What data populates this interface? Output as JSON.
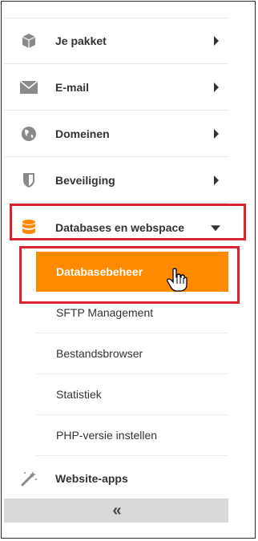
{
  "menu": [
    {
      "label": "Je pakket",
      "icon": "box-icon"
    },
    {
      "label": "E-mail",
      "icon": "envelope-icon"
    },
    {
      "label": "Domeinen",
      "icon": "globe-icon"
    },
    {
      "label": "Beveiliging",
      "icon": "shield-icon"
    },
    {
      "label": "Databases en webspace",
      "icon": "database-icon"
    },
    {
      "label": "Website-apps",
      "icon": "magic-wand-icon"
    }
  ],
  "submenu": {
    "active": "Databasebeheer",
    "items": [
      "SFTP Management",
      "Bestandsbrowser",
      "Statistiek",
      "PHP-versie instellen"
    ]
  },
  "collapse_label": "«",
  "colors": {
    "accent": "#ff8a00",
    "highlight": "#d9232e",
    "icon_gray": "#8a8a8a"
  }
}
